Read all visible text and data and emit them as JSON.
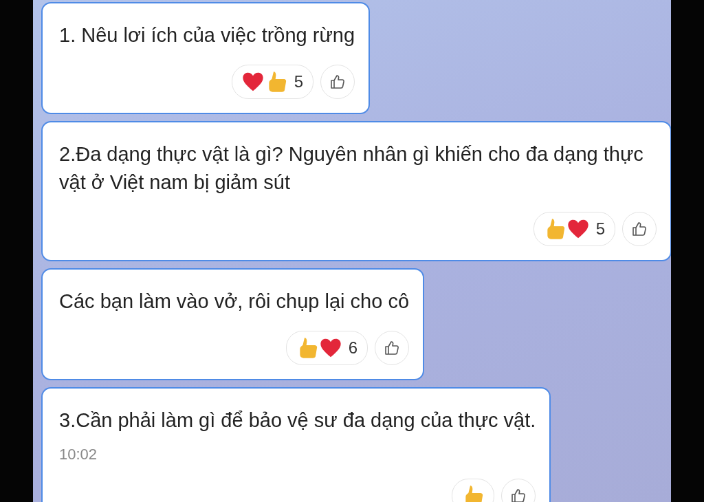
{
  "messages": [
    {
      "text": "1. Nêu lơi ích của việc trồng rừng",
      "reactions": [
        {
          "kind": "heart"
        },
        {
          "kind": "thumb"
        }
      ],
      "count": "5"
    },
    {
      "text": "2.Đa dạng thực vật là gì? Nguyên nhân gì khiến cho đa dạng thực vật ở Việt nam bị giảm sút",
      "reactions": [
        {
          "kind": "thumb"
        },
        {
          "kind": "heart"
        }
      ],
      "count": "5"
    },
    {
      "text": "Các bạn làm vào vở, rôi chụp lại cho cô",
      "reactions": [
        {
          "kind": "thumb"
        },
        {
          "kind": "heart"
        }
      ],
      "count": "6"
    },
    {
      "text": "3.Cần phải làm gì để bảo vệ sư đa dạng của thực vật.",
      "time": "10:02",
      "reactions": [
        {
          "kind": "thumb"
        }
      ]
    }
  ]
}
